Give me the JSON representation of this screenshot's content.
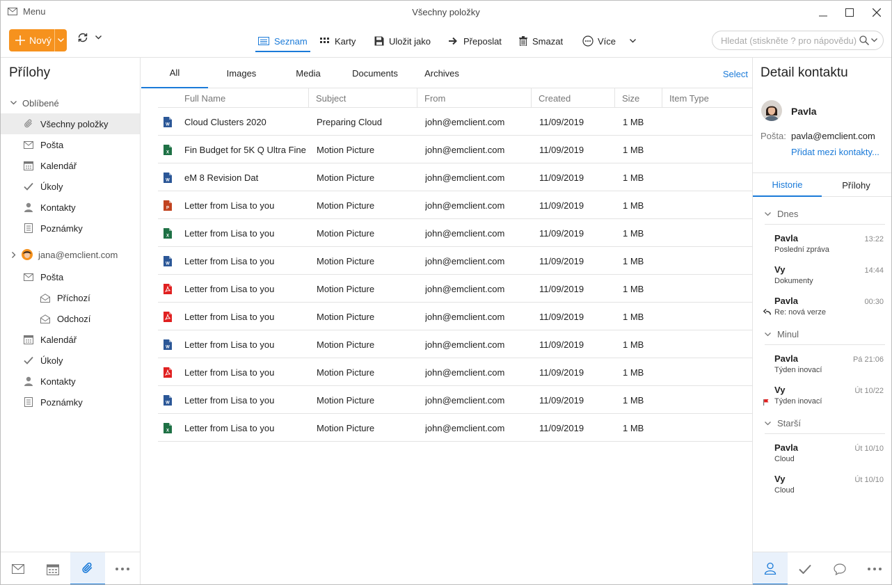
{
  "titlebar": {
    "menu_label": "Menu",
    "title": "Všechny položky"
  },
  "toolbar": {
    "new_label": "Nový",
    "items": [
      {
        "label": "Seznam",
        "icon": "list-icon",
        "active": true
      },
      {
        "label": "Karty",
        "icon": "cards-icon"
      },
      {
        "label": "Uložit jako",
        "icon": "save-icon"
      },
      {
        "label": "Přeposlat",
        "icon": "forward-arrow-icon"
      },
      {
        "label": "Smazat",
        "icon": "trash-icon"
      },
      {
        "label": "Více",
        "icon": "more-circle-icon"
      }
    ],
    "search_placeholder": "Hledat (stiskněte ? pro nápovědu)"
  },
  "sidebar": {
    "title": "Přílohy",
    "favorites_label": "Oblíbené",
    "favorites": [
      {
        "label": "Všechny položky",
        "icon": "paperclip-icon",
        "selected": true
      },
      {
        "label": "Pošta",
        "icon": "mail-icon"
      },
      {
        "label": "Kalendář",
        "icon": "calendar-icon"
      },
      {
        "label": "Úkoly",
        "icon": "check-icon"
      },
      {
        "label": "Kontakty",
        "icon": "person-icon"
      },
      {
        "label": "Poznámky",
        "icon": "notes-icon"
      }
    ],
    "account_label": "jana@emclient.com",
    "account_items": [
      {
        "label": "Pošta",
        "icon": "mail-icon"
      },
      {
        "label": "Příchozí",
        "icon": "inbox-icon",
        "sub": true
      },
      {
        "label": "Odchozí",
        "icon": "outbox-icon",
        "sub": true
      },
      {
        "label": "Kalendář",
        "icon": "calendar-icon"
      },
      {
        "label": "Úkoly",
        "icon": "check-icon"
      },
      {
        "label": "Kontakty",
        "icon": "person-icon"
      },
      {
        "label": "Poznámky",
        "icon": "notes-icon"
      }
    ]
  },
  "main": {
    "tabs": [
      "All",
      "Images",
      "Media",
      "Documents",
      "Archives"
    ],
    "select_label": "Select",
    "columns": [
      "Full Name",
      "Subject",
      "From",
      "Created",
      "Size",
      "Item Type"
    ],
    "rows": [
      {
        "type": "word",
        "name": "Cloud Clusters 2020",
        "subject": "Preparing Cloud",
        "from": "john@emclient.com",
        "created": "11/09/2019",
        "size": "1 MB"
      },
      {
        "type": "excel",
        "name": "Fin Budget for 5K Q Ultra Fine",
        "subject": "Motion Picture",
        "from": "john@emclient.com",
        "created": "11/09/2019",
        "size": "1 MB"
      },
      {
        "type": "word",
        "name": "eM 8 Revision Dat",
        "subject": "Motion Picture",
        "from": "john@emclient.com",
        "created": "11/09/2019",
        "size": "1 MB"
      },
      {
        "type": "ppt",
        "name": "Letter from Lisa to you",
        "subject": "Motion Picture",
        "from": "john@emclient.com",
        "created": "11/09/2019",
        "size": "1 MB"
      },
      {
        "type": "excel",
        "name": "Letter from Lisa to you",
        "subject": "Motion Picture",
        "from": "john@emclient.com",
        "created": "11/09/2019",
        "size": "1 MB"
      },
      {
        "type": "word",
        "name": "Letter from Lisa to you",
        "subject": "Motion Picture",
        "from": "john@emclient.com",
        "created": "11/09/2019",
        "size": "1 MB"
      },
      {
        "type": "pdf",
        "name": "Letter from Lisa to you",
        "subject": "Motion Picture",
        "from": "john@emclient.com",
        "created": "11/09/2019",
        "size": "1 MB"
      },
      {
        "type": "pdf",
        "name": "Letter from Lisa to you",
        "subject": "Motion Picture",
        "from": "john@emclient.com",
        "created": "11/09/2019",
        "size": "1 MB"
      },
      {
        "type": "word",
        "name": "Letter from Lisa to you",
        "subject": "Motion Picture",
        "from": "john@emclient.com",
        "created": "11/09/2019",
        "size": "1 MB"
      },
      {
        "type": "pdf",
        "name": "Letter from Lisa to you",
        "subject": "Motion Picture",
        "from": "john@emclient.com",
        "created": "11/09/2019",
        "size": "1 MB"
      },
      {
        "type": "word",
        "name": "Letter from Lisa to you",
        "subject": "Motion Picture",
        "from": "john@emclient.com",
        "created": "11/09/2019",
        "size": "1 MB"
      },
      {
        "type": "excel",
        "name": "Letter from Lisa to you",
        "subject": "Motion Picture",
        "from": "john@emclient.com",
        "created": "11/09/2019",
        "size": "1 MB"
      }
    ],
    "file_colors": {
      "word": "#2b5797",
      "excel": "#1e7145",
      "ppt": "#c1431f",
      "pdf": "#e02020"
    }
  },
  "contact": {
    "title": "Detail kontaktu",
    "name": "Pavla",
    "email_label": "Pošta:",
    "email": "pavla@emclient.com",
    "add_label": "Přidat mezi kontakty...",
    "tabs": [
      "Historie",
      "Přílohy"
    ],
    "history": [
      {
        "section": "Dnes",
        "items": [
          {
            "name": "Pavla",
            "sub": "Poslední zpráva",
            "time": "13:22"
          },
          {
            "name": "Vy",
            "sub": "Dokumenty",
            "time": "14:44"
          },
          {
            "name": "Pavla",
            "sub": "Re: nová verze",
            "time": "00:30",
            "mark": "reply"
          }
        ]
      },
      {
        "section": "Minul",
        "items": [
          {
            "name": "Pavla",
            "sub": "Týden inovací",
            "time": "Pá 21:06"
          },
          {
            "name": "Vy",
            "sub": "Týden inovací",
            "time": "Út 10/22",
            "mark": "flag"
          }
        ]
      },
      {
        "section": "Starší",
        "items": [
          {
            "name": "Pavla",
            "sub": "Cloud",
            "time": "Út 10/10"
          },
          {
            "name": "Vy",
            "sub": "Cloud",
            "time": "Út 10/10"
          }
        ]
      }
    ]
  },
  "colors": {
    "accent": "#1a7ad8",
    "new_button": "#f6921e",
    "flag": "#e02020"
  }
}
